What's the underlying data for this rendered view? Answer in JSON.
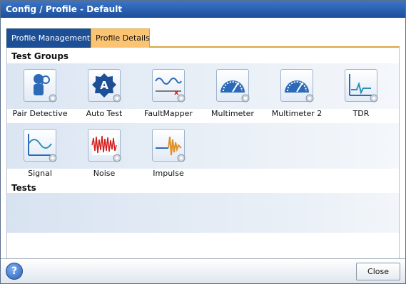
{
  "window": {
    "title": "Config / Profile - Default"
  },
  "tabs": [
    {
      "label": "Profile Management"
    },
    {
      "label": "Profile Details"
    }
  ],
  "test_groups": {
    "heading": "Test Groups",
    "items": [
      {
        "label": "Pair Detective",
        "icon": "pair-detective-icon"
      },
      {
        "label": "Auto Test",
        "icon": "auto-test-icon"
      },
      {
        "label": "FaultMapper",
        "icon": "faultmapper-icon"
      },
      {
        "label": "Multimeter",
        "icon": "multimeter-icon"
      },
      {
        "label": "Multimeter 2",
        "icon": "multimeter-icon"
      },
      {
        "label": "TDR",
        "icon": "tdr-icon"
      },
      {
        "label": "Signal",
        "icon": "signal-icon"
      },
      {
        "label": "Noise",
        "icon": "noise-icon"
      },
      {
        "label": "Impulse",
        "icon": "impulse-icon"
      }
    ]
  },
  "tests": {
    "heading": "Tests"
  },
  "footer": {
    "help_label": "?",
    "close_label": "Close"
  },
  "colors": {
    "title_bar": "#1c4f9c",
    "active_tab": "#1d4f97",
    "selected_tab": "#fbc472",
    "tab_underline": "#d9a441"
  }
}
